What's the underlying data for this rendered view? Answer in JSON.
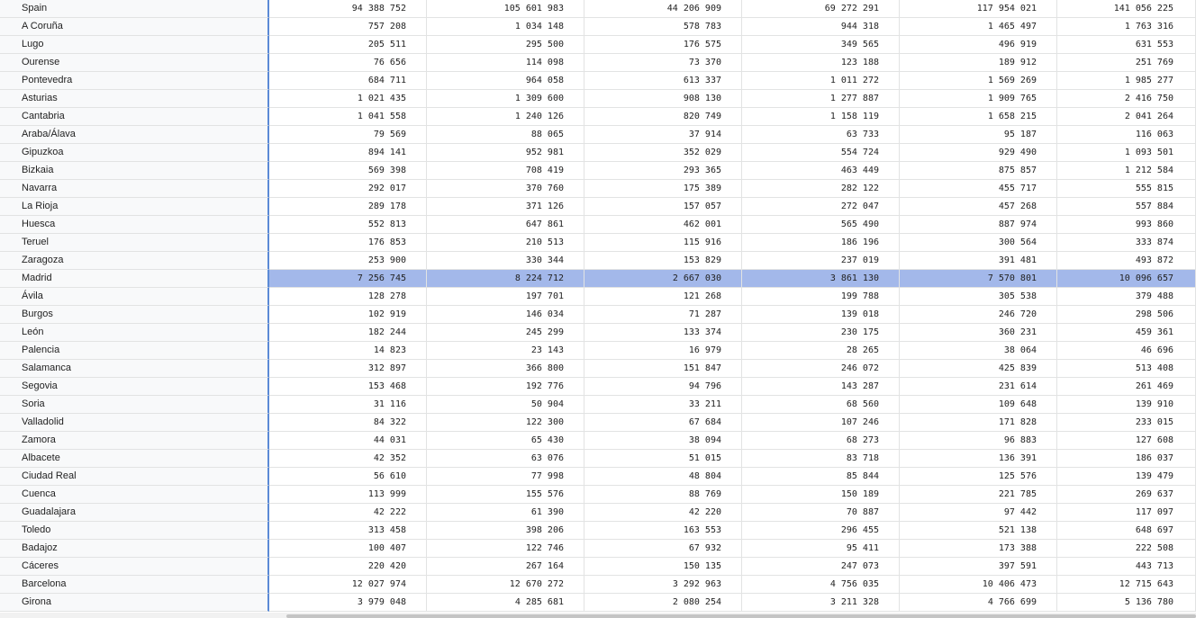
{
  "table": {
    "selected_row": "Madrid",
    "rows": [
      {
        "label": "Spain",
        "values": [
          "94 388 752",
          "105 601 983",
          "44 206 909",
          "69 272 291",
          "117 954 021",
          "141 056 225"
        ]
      },
      {
        "label": "A Coruña",
        "values": [
          "757 208",
          "1 034 148",
          "578 783",
          "944 318",
          "1 465 497",
          "1 763 316"
        ]
      },
      {
        "label": "Lugo",
        "values": [
          "205 511",
          "295 500",
          "176 575",
          "349 565",
          "496 919",
          "631 553"
        ]
      },
      {
        "label": "Ourense",
        "values": [
          "76 656",
          "114 098",
          "73 370",
          "123 188",
          "189 912",
          "251 769"
        ]
      },
      {
        "label": "Pontevedra",
        "values": [
          "684 711",
          "964 058",
          "613 337",
          "1 011 272",
          "1 569 269",
          "1 985 277"
        ]
      },
      {
        "label": "Asturias",
        "values": [
          "1 021 435",
          "1 309 600",
          "908 130",
          "1 277 887",
          "1 909 765",
          "2 416 750"
        ]
      },
      {
        "label": "Cantabria",
        "values": [
          "1 041 558",
          "1 240 126",
          "820 749",
          "1 158 119",
          "1 658 215",
          "2 041 264"
        ]
      },
      {
        "label": "Araba/Álava",
        "values": [
          "79 569",
          "88 065",
          "37 914",
          "63 733",
          "95 187",
          "116 063"
        ]
      },
      {
        "label": "Gipuzkoa",
        "values": [
          "894 141",
          "952 981",
          "352 029",
          "554 724",
          "929 490",
          "1 093 501"
        ]
      },
      {
        "label": "Bizkaia",
        "values": [
          "569 398",
          "708 419",
          "293 365",
          "463 449",
          "875 857",
          "1 212 584"
        ]
      },
      {
        "label": "Navarra",
        "values": [
          "292 017",
          "370 760",
          "175 389",
          "282 122",
          "455 717",
          "555 815"
        ]
      },
      {
        "label": "La Rioja",
        "values": [
          "289 178",
          "371 126",
          "157 057",
          "272 047",
          "457 268",
          "557 884"
        ]
      },
      {
        "label": "Huesca",
        "values": [
          "552 813",
          "647 861",
          "462 001",
          "565 490",
          "887 974",
          "993 860"
        ]
      },
      {
        "label": "Teruel",
        "values": [
          "176 853",
          "210 513",
          "115 916",
          "186 196",
          "300 564",
          "333 874"
        ]
      },
      {
        "label": "Zaragoza",
        "values": [
          "253 900",
          "330 344",
          "153 829",
          "237 019",
          "391 481",
          "493 872"
        ]
      },
      {
        "label": "Madrid",
        "values": [
          "7 256 745",
          "8 224 712",
          "2 667 030",
          "3 861 130",
          "7 570 801",
          "10 096 657"
        ]
      },
      {
        "label": "Ávila",
        "values": [
          "128 278",
          "197 701",
          "121 268",
          "199 788",
          "305 538",
          "379 488"
        ]
      },
      {
        "label": "Burgos",
        "values": [
          "102 919",
          "146 034",
          "71 287",
          "139 018",
          "246 720",
          "298 506"
        ]
      },
      {
        "label": "León",
        "values": [
          "182 244",
          "245 299",
          "133 374",
          "230 175",
          "360 231",
          "459 361"
        ]
      },
      {
        "label": "Palencia",
        "values": [
          "14 823",
          "23 143",
          "16 979",
          "28 265",
          "38 064",
          "46 696"
        ]
      },
      {
        "label": "Salamanca",
        "values": [
          "312 897",
          "366 800",
          "151 847",
          "246 072",
          "425 839",
          "513 408"
        ]
      },
      {
        "label": "Segovia",
        "values": [
          "153 468",
          "192 776",
          "94 796",
          "143 287",
          "231 614",
          "261 469"
        ]
      },
      {
        "label": "Soria",
        "values": [
          "31 116",
          "50 904",
          "33 211",
          "68 560",
          "109 648",
          "139 910"
        ]
      },
      {
        "label": "Valladolid",
        "values": [
          "84 322",
          "122 300",
          "67 684",
          "107 246",
          "171 828",
          "233 015"
        ]
      },
      {
        "label": "Zamora",
        "values": [
          "44 031",
          "65 430",
          "38 094",
          "68 273",
          "96 883",
          "127 608"
        ]
      },
      {
        "label": "Albacete",
        "values": [
          "42 352",
          "63 076",
          "51 015",
          "83 718",
          "136 391",
          "186 037"
        ]
      },
      {
        "label": "Ciudad Real",
        "values": [
          "56 610",
          "77 998",
          "48 804",
          "85 844",
          "125 576",
          "139 479"
        ]
      },
      {
        "label": "Cuenca",
        "values": [
          "113 999",
          "155 576",
          "88 769",
          "150 189",
          "221 785",
          "269 637"
        ]
      },
      {
        "label": "Guadalajara",
        "values": [
          "42 222",
          "61 390",
          "42 220",
          "70 887",
          "97 442",
          "117 097"
        ]
      },
      {
        "label": "Toledo",
        "values": [
          "313 458",
          "398 206",
          "163 553",
          "296 455",
          "521 138",
          "648 697"
        ]
      },
      {
        "label": "Badajoz",
        "values": [
          "100 407",
          "122 746",
          "67 932",
          "95 411",
          "173 388",
          "222 508"
        ]
      },
      {
        "label": "Cáceres",
        "values": [
          "220 420",
          "267 164",
          "150 135",
          "247 073",
          "397 591",
          "443 713"
        ]
      },
      {
        "label": "Barcelona",
        "values": [
          "12 027 974",
          "12 670 272",
          "3 292 963",
          "4 756 035",
          "10 406 473",
          "12 715 643"
        ]
      },
      {
        "label": "Girona",
        "values": [
          "3 979 048",
          "4 285 681",
          "2 080 254",
          "3 211 328",
          "4 766 699",
          "5 136 780"
        ]
      }
    ]
  },
  "colors": {
    "selection": "#a3b8ea",
    "frozen_border": "#5b8ad6",
    "gridline": "#e2e3e3",
    "header_bg": "#f8f9fa"
  }
}
